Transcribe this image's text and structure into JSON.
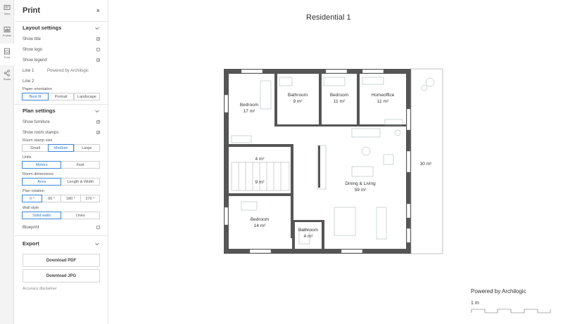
{
  "rail": [
    {
      "label": "View",
      "icon": "view-icon"
    },
    {
      "label": "Profiler",
      "icon": "profiler-icon"
    },
    {
      "label": "Print",
      "icon": "print-icon"
    },
    {
      "label": "Share",
      "icon": "share-icon"
    }
  ],
  "panel": {
    "title": "Print",
    "close": "×",
    "layout": {
      "title": "Layout settings",
      "show_title": "Show title",
      "show_logo": "Show logo",
      "show_legend": "Show legend",
      "line1_label": "Line 1",
      "line1_value": "Powered by Archilogic",
      "line2_label": "Line 2",
      "orientation_label": "Paper orientation",
      "orientation_options": [
        "Best fit",
        "Portrait",
        "Landscape"
      ],
      "checks": {
        "show_title": true,
        "show_logo": false,
        "show_legend": true
      }
    },
    "plan": {
      "title": "Plan settings",
      "show_furniture": "Show furniture",
      "show_room_stamps": "Show room stamps",
      "stamp_size_label": "Room stamp size",
      "stamp_sizes": [
        "Small",
        "Medium",
        "Large"
      ],
      "units_label": "Units",
      "units": [
        "Meters",
        "Feet"
      ],
      "dims_label": "Room dimensions",
      "dims": [
        "Area",
        "Length & Width"
      ],
      "rotation_label": "Plan rotation",
      "rotations": [
        "0 °",
        "90 °",
        "180 °",
        "270 °"
      ],
      "wall_label": "Wall style",
      "walls": [
        "Solid walls",
        "Lines"
      ],
      "blueprint": "Blueprint",
      "checks": {
        "show_furniture": true,
        "show_room_stamps": true,
        "blueprint": false
      }
    },
    "export": {
      "title": "Export",
      "pdf": "Download PDF",
      "jpg": "Download JPG",
      "disclaimer": "Accuracy disclaimer"
    }
  },
  "canvas": {
    "title": "Residential 1",
    "legend": "Powered by Archilogic",
    "scale_label": "1 m",
    "rooms": [
      {
        "name": "Bedroom",
        "area": "17 m²"
      },
      {
        "name": "Bathroom",
        "area": "9 m²"
      },
      {
        "name": "Bedroom",
        "area": "11 m²"
      },
      {
        "name": "Homeoffice",
        "area": "11 m²"
      },
      {
        "name": "",
        "area": "4 m²"
      },
      {
        "name": "",
        "area": "9 m²"
      },
      {
        "name": "Dining & Living",
        "area": "59 m²"
      },
      {
        "name": "",
        "area": "30 m²"
      },
      {
        "name": "Bedroom",
        "area": "14 m²"
      },
      {
        "name": "Bathroom",
        "area": "4 m²"
      }
    ]
  }
}
